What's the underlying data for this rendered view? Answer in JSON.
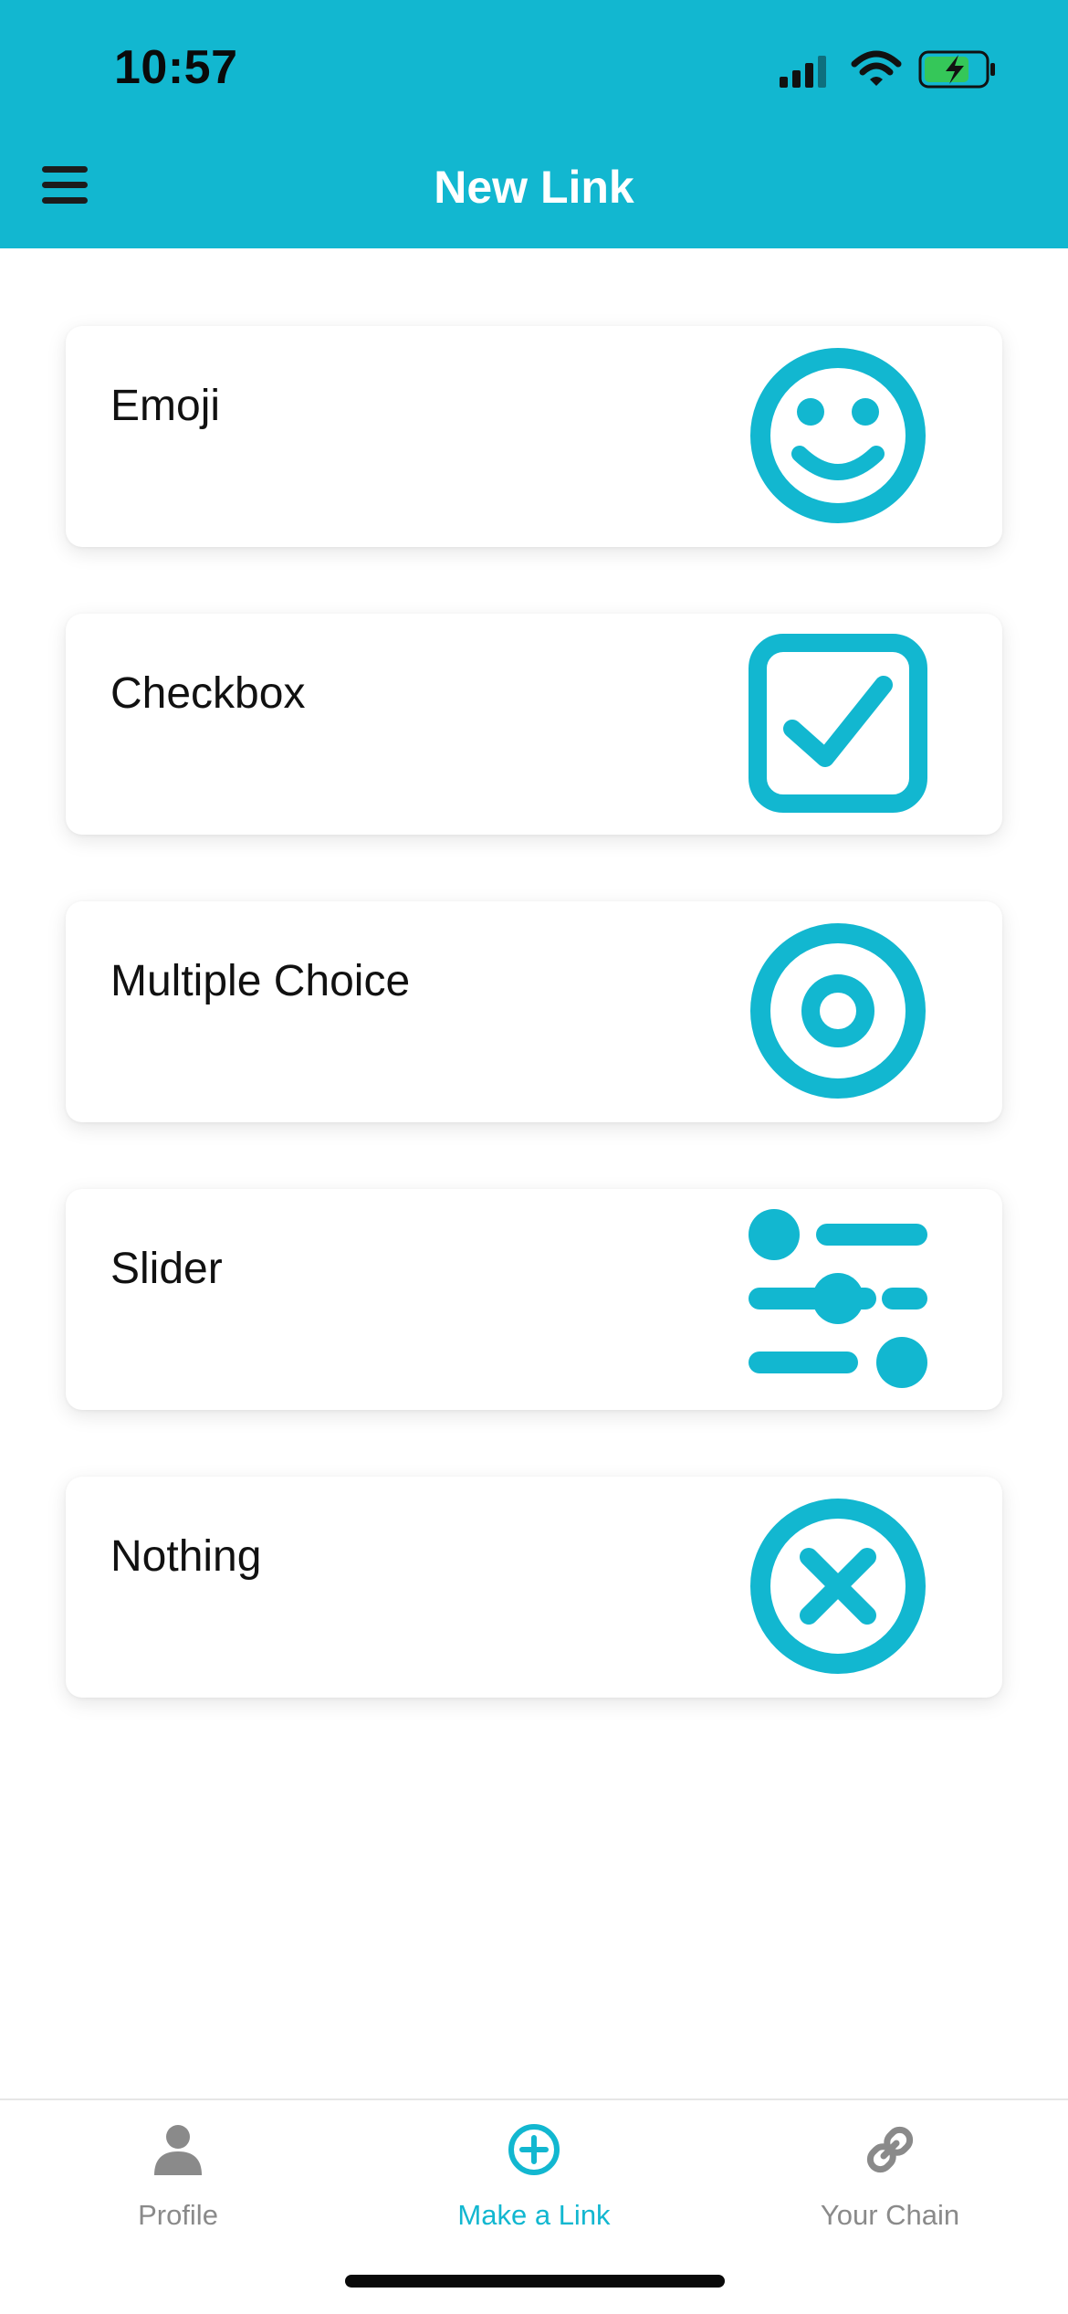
{
  "status_bar": {
    "time": "10:57"
  },
  "header": {
    "title": "New Link",
    "menu_icon": "hamburger-menu-icon"
  },
  "colors": {
    "accent": "#12b7d0",
    "tab_inactive": "#8a8a8a",
    "text": "#111111"
  },
  "options": [
    {
      "label": "Emoji",
      "icon": "smiley-face-icon"
    },
    {
      "label": "Checkbox",
      "icon": "checkbox-checked-icon"
    },
    {
      "label": "Multiple Choice",
      "icon": "radio-button-icon"
    },
    {
      "label": "Slider",
      "icon": "sliders-icon"
    },
    {
      "label": "Nothing",
      "icon": "x-circle-icon"
    }
  ],
  "tabbar": {
    "tabs": [
      {
        "label": "Profile",
        "icon": "person-icon",
        "active": false
      },
      {
        "label": "Make a Link",
        "icon": "plus-circle-icon",
        "active": true
      },
      {
        "label": "Your Chain",
        "icon": "chain-link-icon",
        "active": false
      }
    ]
  }
}
